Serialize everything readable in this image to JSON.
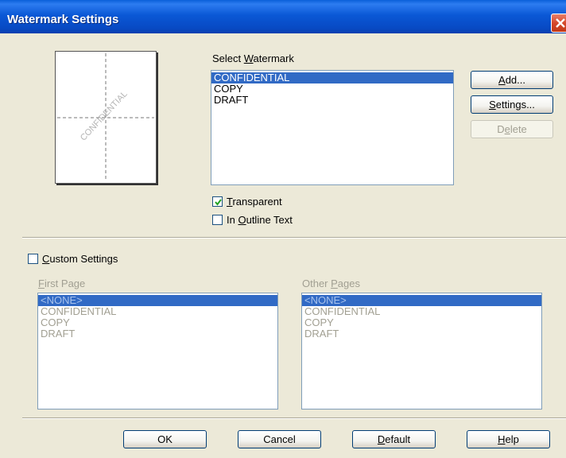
{
  "window": {
    "title": "Watermark Settings"
  },
  "preview": {
    "watermark_text": "CONFIDENTIAL"
  },
  "select_watermark": {
    "label_pre": "Select ",
    "label_key": "W",
    "label_post": "atermark",
    "items": [
      "CONFIDENTIAL",
      "COPY",
      "DRAFT"
    ],
    "selected_index": 0
  },
  "side_buttons": {
    "add": {
      "key": "A",
      "rest": "dd..."
    },
    "settings": {
      "key": "S",
      "rest": "ettings..."
    },
    "delete": {
      "pre": "D",
      "key": "e",
      "rest": "lete"
    }
  },
  "options": {
    "transparent": {
      "key": "T",
      "rest": "ransparent",
      "checked": true
    },
    "outline": {
      "pre": "In ",
      "key": "O",
      "rest": "utline Text",
      "checked": false
    }
  },
  "custom": {
    "key": "C",
    "rest": "ustom Settings",
    "checked": false,
    "first_page": {
      "key": "F",
      "rest": "irst Page",
      "items": [
        "<NONE>",
        "CONFIDENTIAL",
        "COPY",
        "DRAFT"
      ]
    },
    "other_pages": {
      "pre": "Other ",
      "key": "P",
      "rest": "ages",
      "items": [
        "<NONE>",
        "CONFIDENTIAL",
        "COPY",
        "DRAFT"
      ]
    }
  },
  "footer": {
    "ok": "OK",
    "cancel": "Cancel",
    "default": {
      "key": "D",
      "rest": "efault"
    },
    "help": {
      "key": "H",
      "rest": "elp"
    }
  }
}
